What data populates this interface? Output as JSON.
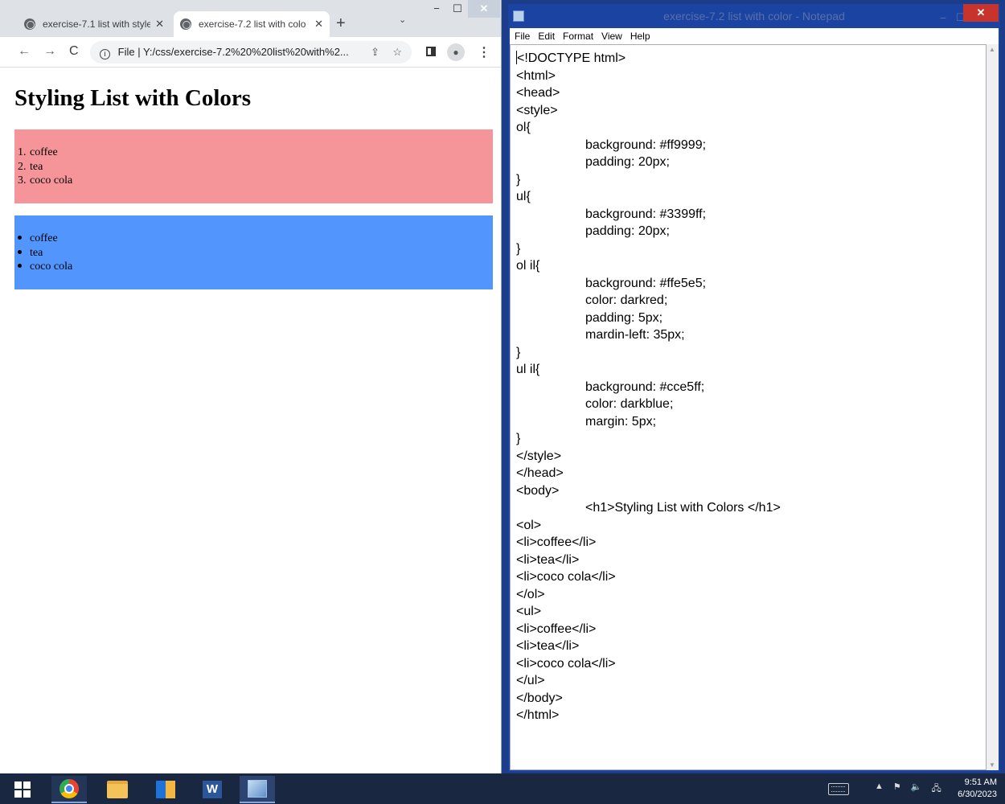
{
  "chrome": {
    "tabs": [
      {
        "title": "exercise-7.1 list with style",
        "close": "✕"
      },
      {
        "title": "exercise-7.2  list with colo",
        "close": "✕"
      }
    ],
    "new_tab": "+",
    "tab_search": "⌄",
    "window_min": "−",
    "window_max": "☐",
    "window_close": "✕",
    "back": "←",
    "forward": "→",
    "reload": "C",
    "url_scheme": "File",
    "url": "Y:/css/exercise-7.2%20%20list%20with%2...",
    "share": "⇪",
    "bookmark": "☆",
    "profile": "●",
    "menu": "⋮"
  },
  "page": {
    "heading": "Styling List with Colors",
    "ordered_list": [
      {
        "marker": "1.",
        "text": "coffee"
      },
      {
        "marker": "2.",
        "text": "tea"
      },
      {
        "marker": "3.",
        "text": "coco cola"
      }
    ],
    "unordered_list": [
      {
        "text": "coffee"
      },
      {
        "text": "tea"
      },
      {
        "text": "coco cola"
      }
    ],
    "colors": {
      "ol_background": "#f69599",
      "ul_background": "#5296fd"
    }
  },
  "notepad": {
    "title": "exercise-7.2  list with color - Notepad",
    "minimize": "−",
    "maximize": "☐",
    "close": "✕",
    "menu": [
      "File",
      "Edit",
      "Format",
      "View",
      "Help"
    ],
    "lines": [
      {
        "text": "<!DOCTYPE html>",
        "indent": false
      },
      {
        "text": "<html>",
        "indent": false
      },
      {
        "text": "<head>",
        "indent": false
      },
      {
        "text": "<style>",
        "indent": false
      },
      {
        "text": "ol{",
        "indent": false
      },
      {
        "text": "background: #ff9999;",
        "indent": true
      },
      {
        "text": "padding: 20px;",
        "indent": true
      },
      {
        "text": "}",
        "indent": false
      },
      {
        "text": "ul{",
        "indent": false
      },
      {
        "text": "background: #3399ff;",
        "indent": true
      },
      {
        "text": "padding: 20px;",
        "indent": true
      },
      {
        "text": "}",
        "indent": false
      },
      {
        "text": "ol il{",
        "indent": false
      },
      {
        "text": "background: #ffe5e5;",
        "indent": true
      },
      {
        "text": "color: darkred;",
        "indent": true
      },
      {
        "text": "padding: 5px;",
        "indent": true
      },
      {
        "text": "mardin-left: 35px;",
        "indent": true
      },
      {
        "text": "}",
        "indent": false
      },
      {
        "text": "ul il{",
        "indent": false
      },
      {
        "text": "background: #cce5ff;",
        "indent": true
      },
      {
        "text": "color: darkblue;",
        "indent": true
      },
      {
        "text": "margin: 5px;",
        "indent": true
      },
      {
        "text": "}",
        "indent": false
      },
      {
        "text": "</style>",
        "indent": false
      },
      {
        "text": "</head>",
        "indent": false
      },
      {
        "text": "<body>",
        "indent": false
      },
      {
        "text": "<h1>Styling List with Colors </h1>",
        "indent": true
      },
      {
        "text": "<ol>",
        "indent": false
      },
      {
        "text": "<li>coffee</li>",
        "indent": false
      },
      {
        "text": "<li>tea</li>",
        "indent": false
      },
      {
        "text": "<li>coco cola</li>",
        "indent": false
      },
      {
        "text": "</ol>",
        "indent": false
      },
      {
        "text": "<ul>",
        "indent": false
      },
      {
        "text": "<li>coffee</li>",
        "indent": false
      },
      {
        "text": "<li>tea</li>",
        "indent": false
      },
      {
        "text": "<li>coco cola</li>",
        "indent": false
      },
      {
        "text": "</ul>",
        "indent": false
      },
      {
        "text": "</body>",
        "indent": false
      },
      {
        "text": "</html>",
        "indent": false
      }
    ]
  },
  "taskbar": {
    "word_label": "W",
    "tray_up": "▲",
    "tray_flag": "⚑",
    "tray_sound": "🔈",
    "tray_network": "🖧",
    "time": "9:51 AM",
    "date": "6/30/2023"
  }
}
